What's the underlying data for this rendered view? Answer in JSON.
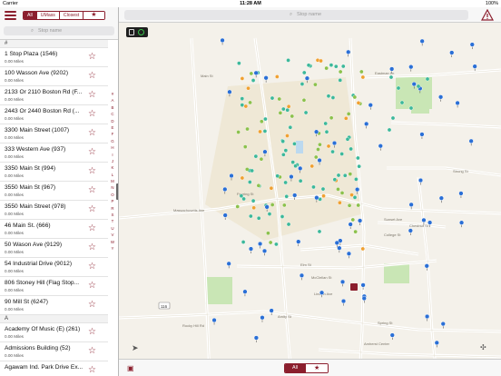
{
  "status": {
    "carrier": "Carrier",
    "time": "11:28 AM",
    "battery": "100%"
  },
  "sidebar": {
    "tabs": [
      "All",
      "UMass",
      "Closest"
    ],
    "favorites_icon": "star-icon",
    "search_placeholder": "Stop name",
    "sections": [
      {
        "header": "#",
        "rows": [
          {
            "name": "1 Stop Plaza (1546)",
            "dist": "0.00 Miles"
          },
          {
            "name": "100 Wasson Ave (9202)",
            "dist": "0.00 Miles"
          },
          {
            "name": "2133 Or 2110 Boston Rd (F...",
            "dist": "0.00 Miles"
          },
          {
            "name": "2443 Or 2440 Boston Rd (...",
            "dist": "0.00 Miles"
          },
          {
            "name": "3300 Main Street (1007)",
            "dist": "0.00 Miles"
          },
          {
            "name": "333 Western Ave (937)",
            "dist": "0.00 Miles"
          },
          {
            "name": "3350 Main St (994)",
            "dist": "0.00 Miles"
          },
          {
            "name": "3550 Main St (967)",
            "dist": "0.00 Miles"
          },
          {
            "name": "3550 Main Street (978)",
            "dist": "0.00 Miles"
          },
          {
            "name": "46 Main St. (666)",
            "dist": "0.00 Miles"
          },
          {
            "name": "50 Wason Ave (9129)",
            "dist": "0.00 Miles"
          },
          {
            "name": "54 Industrial Drive (9012)",
            "dist": "0.00 Miles"
          },
          {
            "name": "806 Stoney Hill (Flag Stop...",
            "dist": "0.00 Miles"
          },
          {
            "name": "90 Mill St (6247)",
            "dist": "0.00 Miles"
          }
        ]
      },
      {
        "header": "A",
        "rows": [
          {
            "name": "Academy Of Music (E) (261)",
            "dist": "0.00 Miles"
          },
          {
            "name": "Admissions Building (52)",
            "dist": "0.00 Miles"
          },
          {
            "name": "Agawam Ind. Park Drive Ex...",
            "dist": ""
          }
        ]
      }
    ],
    "index": [
      "#",
      "A",
      "B",
      "C",
      "D",
      "E",
      "F",
      "G",
      "H",
      "I",
      "J",
      "K",
      "L",
      "M",
      "N",
      "O",
      "P",
      "R",
      "S",
      "T",
      "U",
      "V",
      "W",
      "Y"
    ]
  },
  "map": {
    "search_placeholder": "Stop name",
    "street_labels": [
      "Eastman Ln",
      "Strong St",
      "Massachusetts Ave",
      "Fearing St",
      "Sunset Ave",
      "Chestnut St",
      "Elm St",
      "McClellan St",
      "Amity St",
      "Spring St",
      "College St",
      "Lincoln Ave",
      "Amherst Center",
      "Rocky Hill Rd",
      "Main St"
    ],
    "route_marker": "116",
    "colors": {
      "accent": "#8b1e2d",
      "stop_blue": "#2a6fd6",
      "stop_teal": "#3cb89a",
      "stop_green": "#8cc14c",
      "stop_orange": "#f0a030"
    }
  },
  "bottom": {
    "tabs": [
      "All"
    ],
    "favorites_icon": "star-icon",
    "bus_icon": "bus-icon"
  }
}
